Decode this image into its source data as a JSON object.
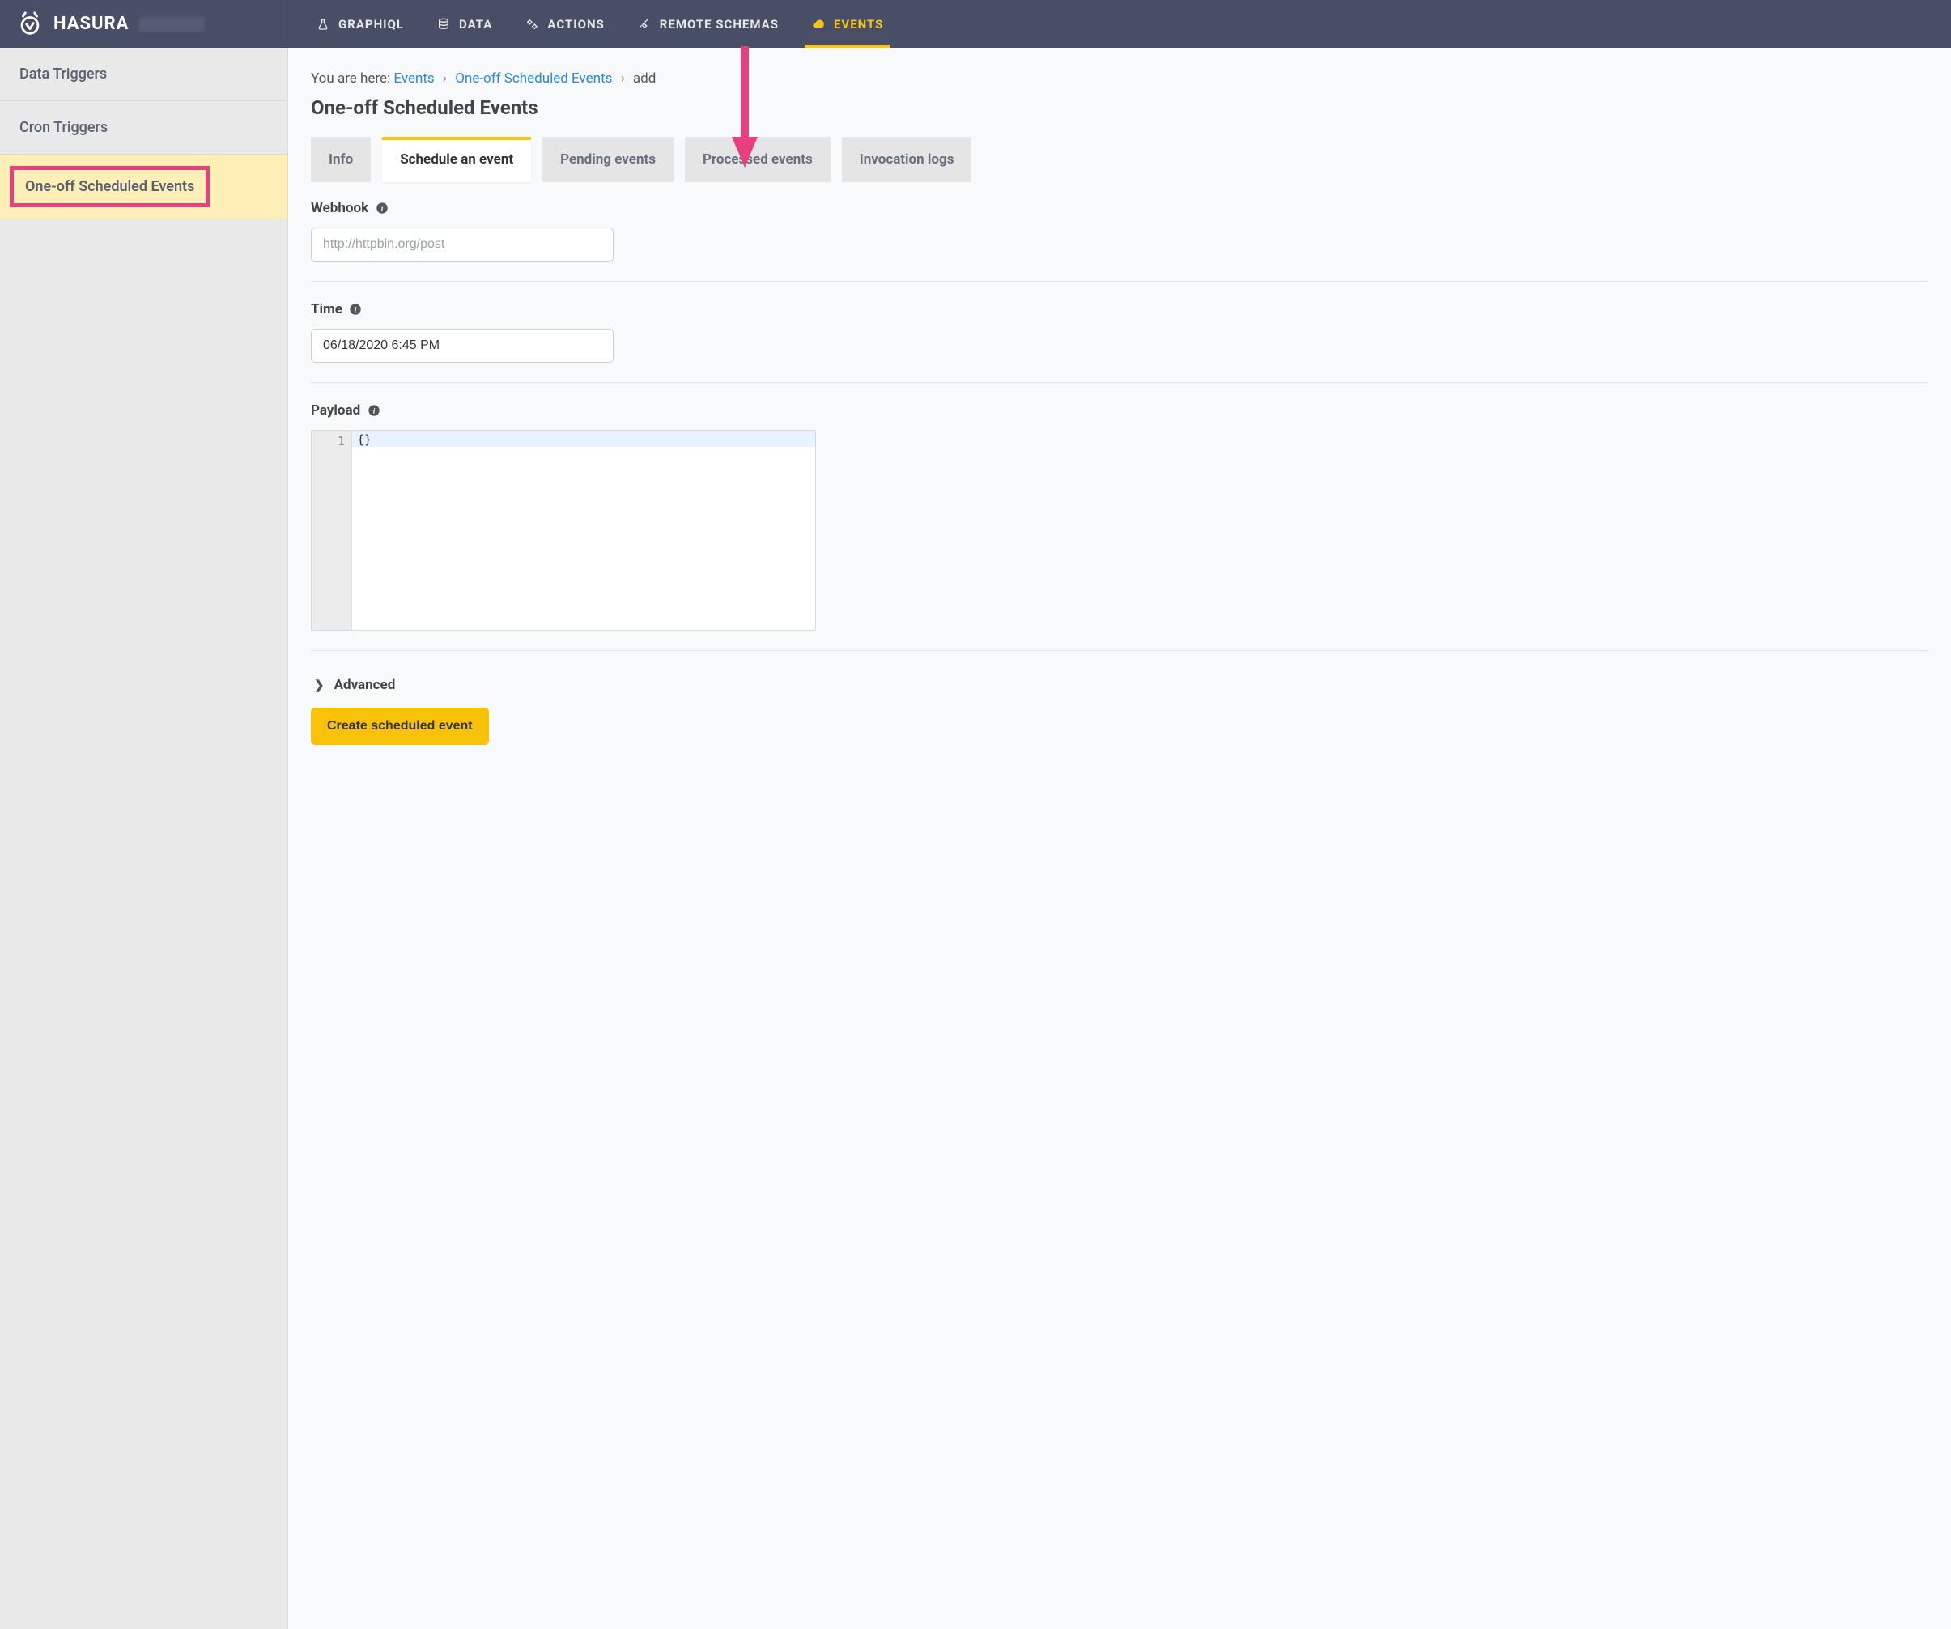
{
  "header": {
    "brand": "HASURA",
    "nav": [
      {
        "label": "GRAPHIQL"
      },
      {
        "label": "DATA"
      },
      {
        "label": "ACTIONS"
      },
      {
        "label": "REMOTE SCHEMAS"
      },
      {
        "label": "EVENTS",
        "active": true
      }
    ]
  },
  "sidebar": {
    "items": [
      {
        "label": "Data Triggers"
      },
      {
        "label": "Cron Triggers"
      },
      {
        "label": "One-off Scheduled Events",
        "active": true
      }
    ]
  },
  "breadcrumb": {
    "prefix": "You are here:",
    "parts": [
      {
        "label": "Events",
        "link": true
      },
      {
        "label": "One-off Scheduled Events",
        "link": true
      },
      {
        "label": "add",
        "link": false
      }
    ]
  },
  "page": {
    "title": "One-off Scheduled Events"
  },
  "tabs": [
    {
      "label": "Info"
    },
    {
      "label": "Schedule an event",
      "active": true
    },
    {
      "label": "Pending events"
    },
    {
      "label": "Processed events"
    },
    {
      "label": "Invocation logs"
    }
  ],
  "form": {
    "webhook": {
      "label": "Webhook",
      "placeholder": "http://httpbin.org/post",
      "value": ""
    },
    "time": {
      "label": "Time",
      "value": "06/18/2020 6:45 PM"
    },
    "payload": {
      "label": "Payload",
      "line_number": "1",
      "value": "{}"
    },
    "advanced": {
      "label": "Advanced"
    },
    "submit": {
      "label": "Create scheduled event"
    }
  },
  "colors": {
    "header_bg": "#484e66",
    "accent": "#f9c513",
    "highlight_border": "#e6407f",
    "highlight_bg": "#fdefb6",
    "link": "#2d87d6"
  }
}
